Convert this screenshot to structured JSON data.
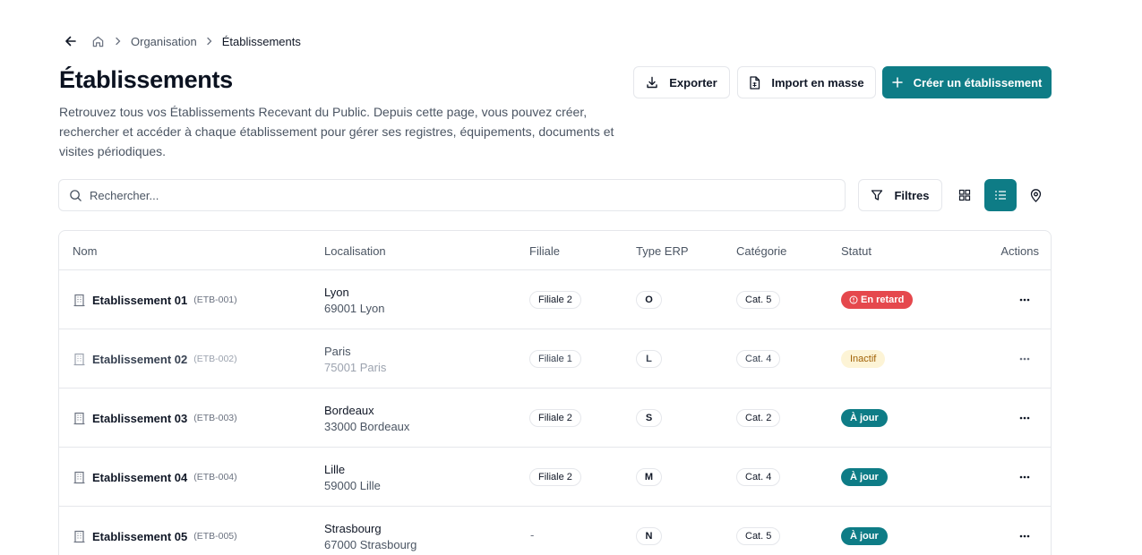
{
  "breadcrumb": {
    "parent": "Organisation",
    "current": "Établissements"
  },
  "header": {
    "title": "Établissements",
    "description": "Retrouvez tous vos Établissements Recevant du Public. Depuis cette page, vous pouvez créer, rechercher et accéder à chaque établissement pour gérer ses registres, équipements, documents et visites périodiques."
  },
  "toolbar": {
    "export_label": "Exporter",
    "import_label": "Import en masse",
    "create_label": "Créer un établissement",
    "search_placeholder": "Rechercher...",
    "filters_label": "Filtres",
    "active_view": "list"
  },
  "table": {
    "columns": {
      "name": "Nom",
      "location": "Localisation",
      "branch": "Filiale",
      "erp_type": "Type ERP",
      "category": "Catégorie",
      "status": "Statut",
      "actions": "Actions"
    },
    "rows": [
      {
        "name": "Etablissement 01",
        "code": "(ETB-001)",
        "city": "Lyon",
        "zip": "69001 Lyon",
        "branch": "Filiale 2",
        "type": "O",
        "category": "Cat. 5",
        "status": "En retard",
        "status_kind": "late"
      },
      {
        "name": "Etablissement 02",
        "code": "(ETB-002)",
        "city": "Paris",
        "zip": "75001 Paris",
        "branch": "Filiale 1",
        "type": "L",
        "category": "Cat. 4",
        "status": "Inactif",
        "status_kind": "inactive"
      },
      {
        "name": "Etablissement 03",
        "code": "(ETB-003)",
        "city": "Bordeaux",
        "zip": "33000 Bordeaux",
        "branch": "Filiale 2",
        "type": "S",
        "category": "Cat. 2",
        "status": "À jour",
        "status_kind": "ok"
      },
      {
        "name": "Etablissement 04",
        "code": "(ETB-004)",
        "city": "Lille",
        "zip": "59000 Lille",
        "branch": "Filiale 2",
        "type": "M",
        "category": "Cat. 4",
        "status": "À jour",
        "status_kind": "ok"
      },
      {
        "name": "Etablissement 05",
        "code": "(ETB-005)",
        "city": "Strasbourg",
        "zip": "67000 Strasbourg",
        "branch": "-",
        "type": "N",
        "category": "Cat. 5",
        "status": "À jour",
        "status_kind": "ok"
      }
    ]
  },
  "colors": {
    "primary": "#0e7c86",
    "late": "#e5484d",
    "inactive_bg": "#fdf4d6",
    "inactive_text": "#a16207"
  }
}
